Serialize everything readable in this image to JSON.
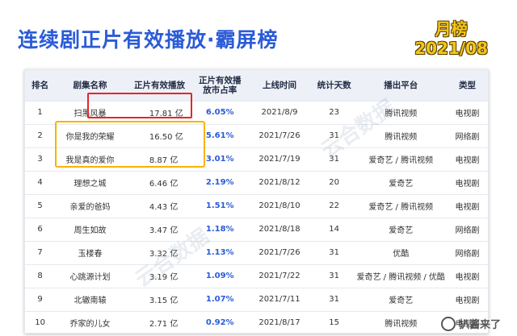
{
  "header": {
    "title": "连续剧正片有效播放·霸屏榜",
    "badge_line1": "月榜",
    "badge_line2": "2021/08"
  },
  "table": {
    "columns": [
      "排名",
      "剧集名称",
      "正片有效播放",
      "正片有效播放市占率",
      "上线时间",
      "统计天数",
      "播出平台",
      "类型"
    ],
    "rows": [
      [
        "1",
        "扫黑风暴",
        "17.81 亿",
        "6.05%",
        "2021/8/9",
        "23",
        "腾讯视频",
        "电视剧"
      ],
      [
        "2",
        "你是我的荣耀",
        "16.50 亿",
        "5.61%",
        "2021/7/26",
        "31",
        "腾讯视频",
        "网络剧"
      ],
      [
        "3",
        "我是真的爱你",
        "8.87 亿",
        "3.01%",
        "2021/7/19",
        "31",
        "爱奇艺 / 腾讯视频",
        "电视剧"
      ],
      [
        "4",
        "理想之城",
        "6.46 亿",
        "2.19%",
        "2021/8/12",
        "20",
        "爱奇艺",
        "电视剧"
      ],
      [
        "5",
        "亲爱的爸妈",
        "4.43 亿",
        "1.51%",
        "2021/8/10",
        "22",
        "爱奇艺 / 腾讯视频",
        "电视剧"
      ],
      [
        "6",
        "周生如故",
        "3.47 亿",
        "1.18%",
        "2021/8/18",
        "14",
        "爱奇艺",
        "网络剧"
      ],
      [
        "7",
        "玉楼春",
        "3.32 亿",
        "1.13%",
        "2021/7/26",
        "31",
        "优酷",
        "网络剧"
      ],
      [
        "8",
        "心跳源计划",
        "3.19 亿",
        "1.09%",
        "2021/7/22",
        "31",
        "爱奇艺 / 腾讯视频 / 优酷",
        "电视剧"
      ],
      [
        "9",
        "北辙南辕",
        "3.15 亿",
        "1.07%",
        "2021/7/11",
        "31",
        "爱奇艺",
        "电视剧"
      ],
      [
        "10",
        "乔家的儿女",
        "2.71 亿",
        "0.92%",
        "2021/8/17",
        "15",
        "腾讯视频",
        "电视剧"
      ]
    ]
  },
  "watermark": "云合数据",
  "logo": {
    "text": "扒酱来了"
  },
  "colors": {
    "title": "#2b5bd7",
    "highlight_red": "#e8242b",
    "highlight_yellow": "#f5b400",
    "badge": "#f5c518"
  },
  "chart_data": {
    "type": "table",
    "title": "连续剧正片有效播放·霸屏榜",
    "columns": [
      "排名",
      "剧集名称",
      "正片有效播放",
      "正片有效播放市占率",
      "上线时间",
      "统计天数",
      "播出平台",
      "类型"
    ],
    "categories": [
      "扫黑风暴",
      "你是我的荣耀",
      "我是真的爱你",
      "理想之城",
      "亲爱的爸妈",
      "周生如故",
      "玉楼春",
      "心跳源计划",
      "北辙南辕",
      "乔家的儿女"
    ],
    "series": [
      {
        "name": "正片有效播放",
        "values": [
          17.81,
          16.5,
          8.87,
          6.46,
          4.43,
          3.47,
          3.32,
          3.19,
          3.15,
          2.71
        ]
      },
      {
        "name": "正片有效播放市占率",
        "values": [
          6.05,
          5.61,
          3.01,
          2.19,
          1.51,
          1.18,
          1.13,
          1.09,
          1.07,
          0.92
        ]
      }
    ]
  }
}
